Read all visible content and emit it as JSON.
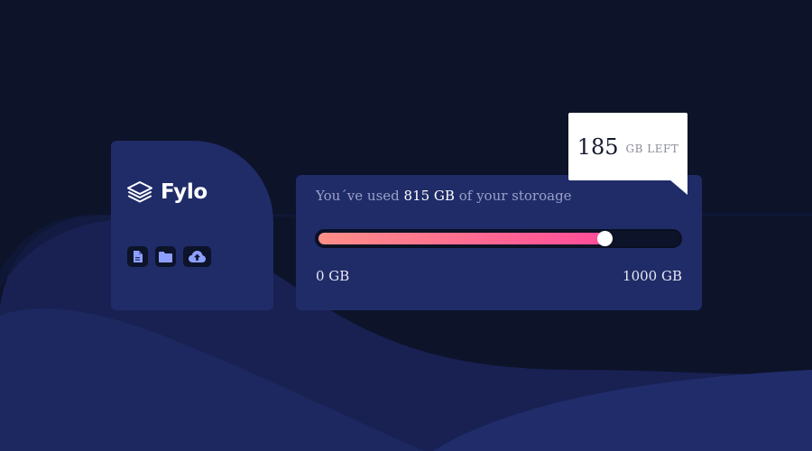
{
  "brand": {
    "name": "Fylo"
  },
  "toolbar": {
    "buttons": [
      {
        "icon": "document-icon",
        "label": ""
      },
      {
        "icon": "folder-icon",
        "label": ""
      },
      {
        "icon": "cloud-upload-icon",
        "label": ""
      }
    ]
  },
  "usage": {
    "prefix": "You´ve used",
    "used": "815 GB",
    "suffix": "of your storoage",
    "used_value_gb": 815,
    "capacity_gb": 1000,
    "fill_fraction": 0.815,
    "scale_min": "0 GB",
    "scale_max": "1000 GB"
  },
  "callout": {
    "remaining": "185",
    "unit": "GB LEFT"
  },
  "colors": {
    "background": "#0d1329",
    "card": "#1f2c68",
    "bar_gradient_start": "#ff8f88",
    "bar_gradient_end": "#ff4b9a",
    "icon_accent": "#8da0ff"
  }
}
